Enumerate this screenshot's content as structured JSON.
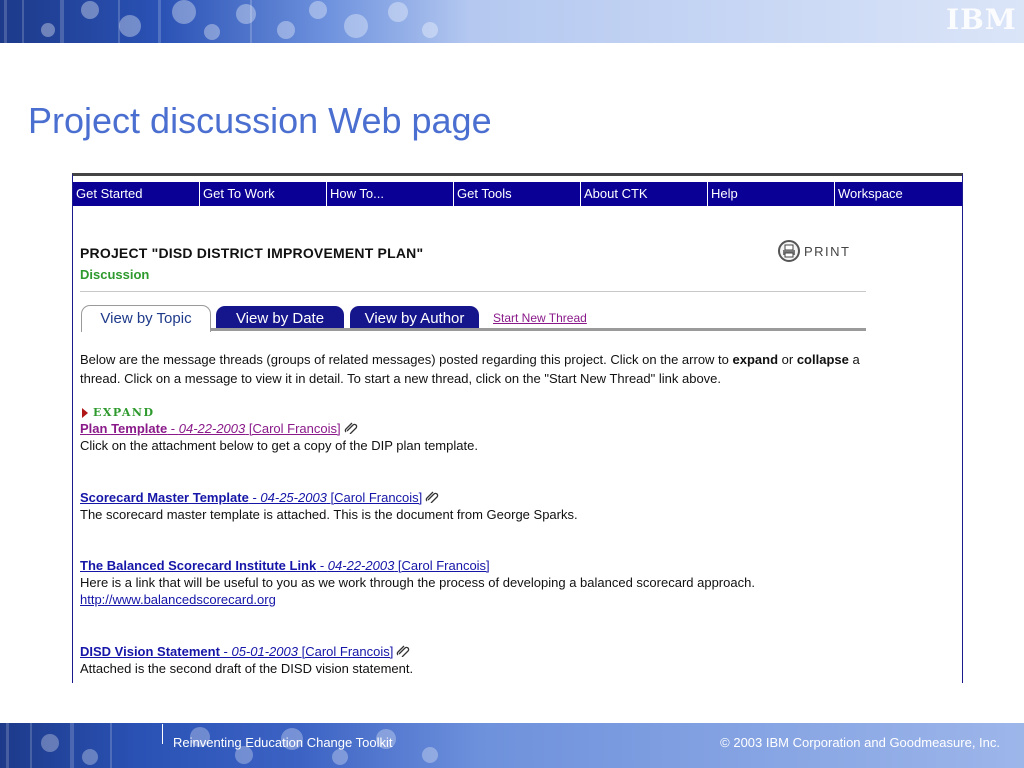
{
  "slide": {
    "title": "Project discussion Web page",
    "logo": "IBM",
    "footer_left": "Reinventing Education Change Toolkit",
    "footer_right": "© 2003 IBM Corporation and Goodmeasure, Inc.",
    "colors": {
      "banner": "#2a52b5",
      "title": "#4b6fd0"
    }
  },
  "nav": {
    "items": [
      "Get Started",
      "Get To Work",
      "How To...",
      "Get Tools",
      "About CTK",
      "Help",
      "Workspace"
    ],
    "color": "#0a0096"
  },
  "page": {
    "project_title": "PROJECT \"DISD DISTRICT IMPROVEMENT PLAN\"",
    "section": "Discussion",
    "print_label": "PRINT"
  },
  "tabs": {
    "by_topic": "View by Topic",
    "by_date": "View by Date",
    "by_author": "View by Author",
    "active": "View by Topic",
    "new_thread": "Start New Thread"
  },
  "intro": {
    "part1": "Below are the message threads (groups of related messages) posted regarding this project. Click on the arrow to ",
    "expand_word": "expand",
    "part2": " or ",
    "collapse_word": "collapse",
    "part3": " a thread. Click on a message to view it in detail. To start a new thread, click on the \"Start New Thread\" link above."
  },
  "expand_label": "EXPAND",
  "threads": [
    {
      "title": "Plan Template",
      "date": "04-22-2003",
      "author": "[Carol Francois]",
      "body": "Click on the attachment below to get a copy of the DIP plan template.",
      "attachment": true
    },
    {
      "title": "Scorecard Master Template",
      "date": "04-25-2003",
      "author": "[Carol Francois]",
      "body": "The scorecard master template is attached. This is the document from George Sparks.",
      "attachment": true
    },
    {
      "title": "The Balanced Scorecard Institute Link",
      "date": "04-22-2003",
      "author": "[Carol Francois]",
      "body": "Here is a link that will be useful to you as we work through the process of developing a balanced scorecard approach.",
      "url": "http://www.balancedscorecard.org",
      "attachment": false
    },
    {
      "title": "DISD Vision Statement",
      "date": "05-01-2003",
      "author": "[Carol Francois]",
      "body": "Attached is the second draft of the DISD vision statement.",
      "attachment": true
    }
  ],
  "separator": " - "
}
